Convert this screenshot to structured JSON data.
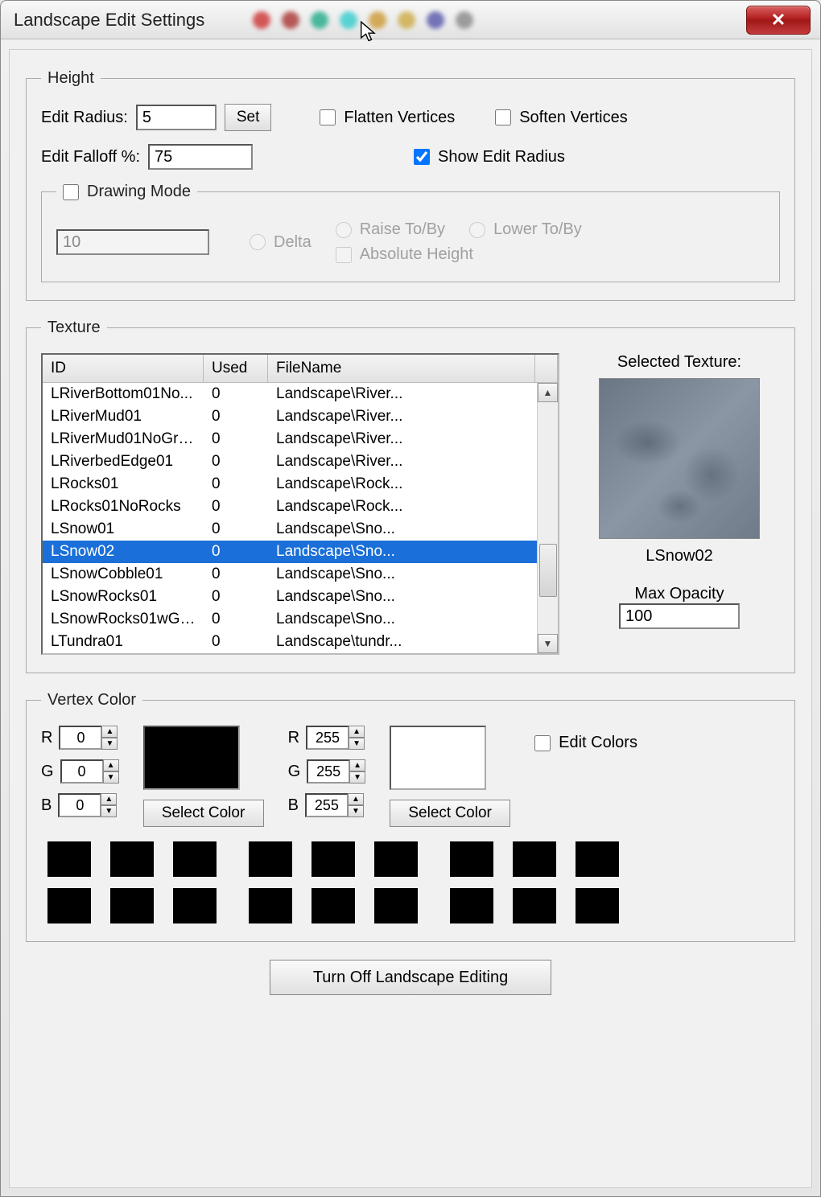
{
  "window": {
    "title": "Landscape Edit Settings"
  },
  "height_group": {
    "legend": "Height",
    "edit_radius_label": "Edit Radius:",
    "edit_radius_value": "5",
    "set_button": "Set",
    "flatten_label": "Flatten Vertices",
    "soften_label": "Soften Vertices",
    "falloff_label": "Edit Falloff %:",
    "falloff_value": "75",
    "show_radius_label": "Show Edit Radius",
    "show_radius_checked": true,
    "drawing": {
      "legend": "Drawing Mode",
      "enabled": false,
      "value": "10",
      "delta_label": "Delta",
      "raise_label": "Raise To/By",
      "lower_label": "Lower To/By",
      "absolute_label": "Absolute Height"
    }
  },
  "texture_group": {
    "legend": "Texture",
    "columns": {
      "id": "ID",
      "used": "Used",
      "file": "FileName"
    },
    "rows": [
      {
        "id": "LRiverBottom01No...",
        "used": "0",
        "file": "Landscape\\River..."
      },
      {
        "id": "LRiverMud01",
        "used": "0",
        "file": "Landscape\\River..."
      },
      {
        "id": "LRiverMud01NoGra...",
        "used": "0",
        "file": "Landscape\\River..."
      },
      {
        "id": "LRiverbedEdge01",
        "used": "0",
        "file": "Landscape\\River..."
      },
      {
        "id": "LRocks01",
        "used": "0",
        "file": "Landscape\\Rock..."
      },
      {
        "id": "LRocks01NoRocks",
        "used": "0",
        "file": "Landscape\\Rock..."
      },
      {
        "id": "LSnow01",
        "used": "0",
        "file": "Landscape\\Sno..."
      },
      {
        "id": "LSnow02",
        "used": "0",
        "file": "Landscape\\Sno...",
        "selected": true
      },
      {
        "id": "LSnowCobble01",
        "used": "0",
        "file": "Landscape\\Sno..."
      },
      {
        "id": "LSnowRocks01",
        "used": "0",
        "file": "Landscape\\Sno..."
      },
      {
        "id": "LSnowRocks01wGr...",
        "used": "0",
        "file": "Landscape\\Sno..."
      },
      {
        "id": "LTundra01",
        "used": "0",
        "file": "Landscape\\tundr..."
      }
    ],
    "selected_label": "Selected Texture:",
    "selected_name": "LSnow02",
    "max_opacity_label": "Max Opacity",
    "max_opacity_value": "100"
  },
  "vertex_group": {
    "legend": "Vertex Color",
    "r_label": "R",
    "g_label": "G",
    "b_label": "B",
    "color1": {
      "r": "0",
      "g": "0",
      "b": "0"
    },
    "color2": {
      "r": "255",
      "g": "255",
      "b": "255"
    },
    "select_color_label": "Select Color",
    "edit_colors_label": "Edit Colors"
  },
  "bottom_button": "Turn Off Landscape Editing"
}
